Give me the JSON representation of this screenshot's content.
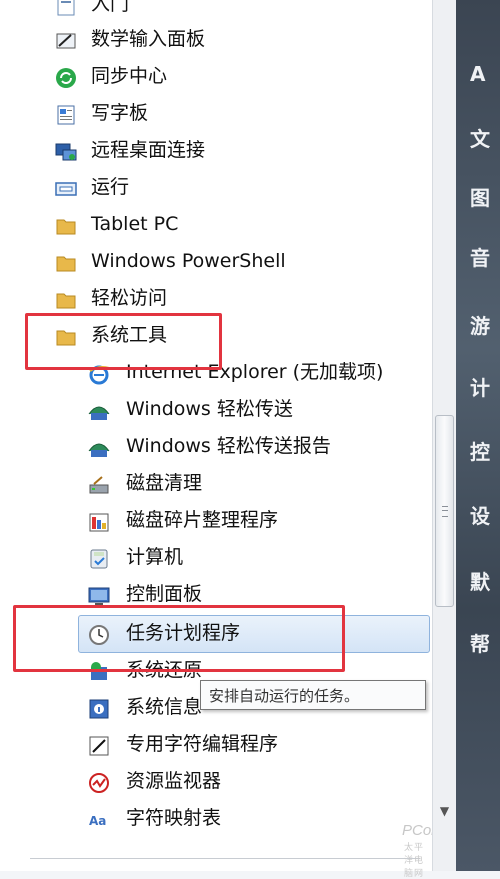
{
  "menu": {
    "items_top": [
      {
        "label": "入门",
        "icon": "getting-started-icon"
      },
      {
        "label": "数学输入面板",
        "icon": "math-input-icon"
      },
      {
        "label": "同步中心",
        "icon": "sync-center-icon"
      },
      {
        "label": "写字板",
        "icon": "wordpad-icon"
      },
      {
        "label": "远程桌面连接",
        "icon": "remote-desktop-icon"
      },
      {
        "label": "运行",
        "icon": "run-icon"
      },
      {
        "label": "Tablet PC",
        "icon": "folder-icon"
      },
      {
        "label": "Windows PowerShell",
        "icon": "folder-icon"
      },
      {
        "label": "轻松访问",
        "icon": "folder-icon"
      },
      {
        "label": "系统工具",
        "icon": "folder-icon"
      }
    ],
    "items_sub": [
      {
        "label": "Internet Explorer (无加载项)",
        "icon": "internet-explorer-icon"
      },
      {
        "label": "Windows 轻松传送",
        "icon": "easy-transfer-icon"
      },
      {
        "label": "Windows 轻松传送报告",
        "icon": "easy-transfer-report-icon"
      },
      {
        "label": "磁盘清理",
        "icon": "disk-cleanup-icon"
      },
      {
        "label": "磁盘碎片整理程序",
        "icon": "defragmenter-icon"
      },
      {
        "label": "计算机",
        "icon": "computer-icon"
      },
      {
        "label": "控制面板",
        "icon": "control-panel-icon"
      },
      {
        "label": "任务计划程序",
        "icon": "task-scheduler-icon"
      },
      {
        "label": "系统还原",
        "icon": "system-restore-icon"
      },
      {
        "label": "系统信息",
        "icon": "system-info-icon"
      },
      {
        "label": "专用字符编辑程序",
        "icon": "private-char-editor-icon"
      },
      {
        "label": "资源监视器",
        "icon": "resource-monitor-icon"
      },
      {
        "label": "字符映射表",
        "icon": "character-map-icon"
      }
    ]
  },
  "tooltip": {
    "text": "安排自动运行的任务。"
  },
  "right_pane": {
    "glyphs": [
      "A",
      "文",
      "图",
      "音",
      "游",
      "计",
      "控",
      "设",
      "默",
      "帮"
    ]
  },
  "watermark": {
    "brand": "PConline",
    "sub": "太平洋电脑网"
  },
  "colors": {
    "highlight_border": "#e2343f",
    "selection": "#d4e4f6"
  }
}
